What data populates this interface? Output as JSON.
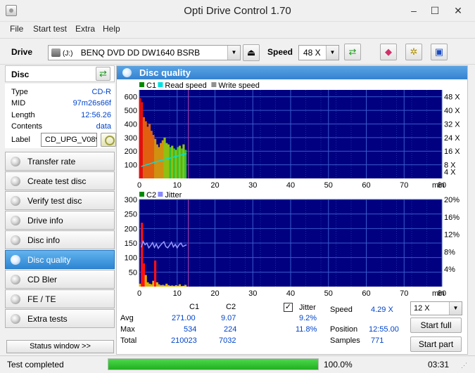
{
  "window": {
    "title": "Opti Drive Control 1.70",
    "minimize": "–",
    "maximize": "☐",
    "close": "✕"
  },
  "menu": [
    "File",
    "Start test",
    "Extra",
    "Help"
  ],
  "toolbar": {
    "drive_label": "Drive",
    "drive_prefix": "(J:)",
    "drive_value": "BENQ DVD DD DW1640 BSRB",
    "speed_label": "Speed",
    "speed_value": "48 X"
  },
  "disc": {
    "header": "Disc",
    "rows": [
      {
        "label": "Type",
        "value": "CD-R"
      },
      {
        "label": "MID",
        "value": "97m26s66f"
      },
      {
        "label": "Length",
        "value": "12:56.26"
      },
      {
        "label": "Contents",
        "value": "data"
      }
    ],
    "label_caption": "Label",
    "label_value": "CD_UPG_V089"
  },
  "nav": [
    {
      "label": "Transfer rate",
      "active": false
    },
    {
      "label": "Create test disc",
      "active": false
    },
    {
      "label": "Verify test disc",
      "active": false
    },
    {
      "label": "Drive info",
      "active": false
    },
    {
      "label": "Disc info",
      "active": false
    },
    {
      "label": "Disc quality",
      "active": true
    },
    {
      "label": "CD Bler",
      "active": false
    },
    {
      "label": "FE / TE",
      "active": false
    },
    {
      "label": "Extra tests",
      "active": false
    }
  ],
  "status_window_button": "Status window >>",
  "panel_title": "Disc quality",
  "chart_data": [
    {
      "type": "bar",
      "legend": [
        "C1",
        "Read speed",
        "Write speed"
      ],
      "legend_colors": [
        "#008800",
        "#00e0e0",
        "#909090"
      ],
      "x_ticks": [
        "0",
        "10",
        "20",
        "30",
        "40",
        "50",
        "60",
        "70",
        "80"
      ],
      "x_unit": "min",
      "xlim": [
        0,
        80
      ],
      "y_ticks": [
        "100",
        "200",
        "300",
        "400",
        "500",
        "600"
      ],
      "ylim": [
        0,
        650
      ],
      "y2_ticks": [
        "4 X",
        "8 X",
        "16 X",
        "24 X",
        "32 X",
        "40 X",
        "48 X"
      ],
      "disc_end_min": 12.94,
      "x": [
        0.5,
        1.0,
        1.5,
        2.0,
        2.5,
        3.0,
        3.5,
        4.0,
        4.5,
        5.0,
        5.5,
        6.0,
        6.5,
        7.0,
        7.5,
        8.0,
        8.5,
        9.0,
        9.5,
        10.0,
        10.5,
        11.0,
        11.5,
        12.0,
        12.5
      ],
      "c1": [
        590,
        560,
        450,
        420,
        380,
        400,
        350,
        320,
        290,
        250,
        230,
        260,
        280,
        300,
        260,
        250,
        230,
        240,
        220,
        210,
        230,
        240,
        220,
        250,
        210
      ],
      "read_speed": [
        7,
        7.4,
        7.7,
        8.1,
        8.4,
        8.8,
        9.1,
        9.5,
        9.8,
        10.1,
        10.4,
        10.7,
        11.0,
        11.3,
        11.6,
        11.9,
        12.2,
        12.5,
        12.8,
        13.1,
        13.4,
        13.7,
        14.0,
        14.3,
        14.6
      ]
    },
    {
      "type": "bar",
      "legend": [
        "C2",
        "Jitter"
      ],
      "legend_colors": [
        "#008800",
        "#8888ff"
      ],
      "x_ticks": [
        "0",
        "10",
        "20",
        "30",
        "40",
        "50",
        "60",
        "70",
        "80"
      ],
      "x_unit": "min",
      "xlim": [
        0,
        80
      ],
      "y_ticks": [
        "50",
        "100",
        "150",
        "200",
        "250",
        "300"
      ],
      "ylim": [
        0,
        300
      ],
      "y2_ticks": [
        "4%",
        "8%",
        "12%",
        "16%",
        "20%"
      ],
      "disc_end_min": 12.94,
      "x": [
        0.5,
        1.0,
        1.5,
        2.0,
        2.5,
        3.0,
        3.5,
        4.0,
        4.5,
        5.0,
        5.5,
        6.0,
        6.5,
        7.0,
        7.5,
        8.0,
        8.5,
        9.0,
        9.5,
        10.0,
        10.5,
        11.0,
        11.5,
        12.0,
        12.5
      ],
      "c2": [
        10,
        220,
        80,
        40,
        15,
        10,
        8,
        20,
        90,
        15,
        8,
        5,
        6,
        4,
        10,
        5,
        3,
        4,
        2,
        5,
        3,
        8,
        2,
        3,
        6
      ],
      "jitter": [
        9.0,
        10.4,
        9.6,
        10.0,
        8.9,
        9.4,
        10.1,
        9.0,
        9.8,
        8.8,
        9.4,
        9.9,
        10.3,
        9.2,
        8.9,
        9.5,
        10.2,
        9.1,
        9.7,
        8.9,
        9.6,
        10.0,
        9.2,
        9.4,
        9.6
      ]
    }
  ],
  "stats": {
    "col_c1": "C1",
    "col_c2": "C2",
    "jitter_label": "Jitter",
    "jitter_checked": "✓",
    "avg_label": "Avg",
    "avg_c1": "271.00",
    "avg_c2": "9.07",
    "avg_jitter": "9.2%",
    "max_label": "Max",
    "max_c1": "534",
    "max_c2": "224",
    "max_jitter": "11.8%",
    "total_label": "Total",
    "total_c1": "210023",
    "total_c2": "7032",
    "speed_label": "Speed",
    "speed_value": "4.29 X",
    "position_label": "Position",
    "position_value": "12:55.00",
    "samples_label": "Samples",
    "samples_value": "771",
    "test_speed": "12 X",
    "start_full": "Start full",
    "start_part": "Start part"
  },
  "statusbar": {
    "text": "Test completed",
    "progress": 100,
    "progress_text": "100.0%",
    "time": "03:31"
  },
  "colors": {
    "accent": "#3582d0",
    "chart_bg": "#000080",
    "grid": "#3a5acc"
  }
}
